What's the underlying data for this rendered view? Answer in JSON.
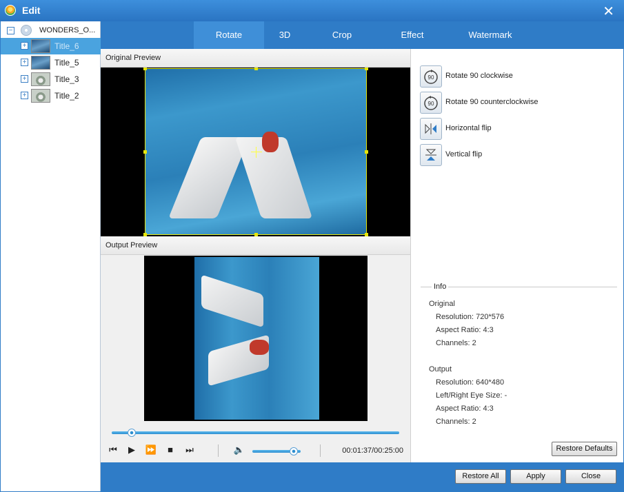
{
  "window": {
    "title": "Edit"
  },
  "tree": {
    "root_label": "WONDERS_O...",
    "items": [
      {
        "label": "Title_6",
        "selected": true,
        "thumb": "sea"
      },
      {
        "label": "Title_5",
        "selected": false,
        "thumb": "sea"
      },
      {
        "label": "Title_3",
        "selected": false,
        "thumb": "drop"
      },
      {
        "label": "Title_2",
        "selected": false,
        "thumb": "drop"
      }
    ]
  },
  "tabs": [
    {
      "label": "Rotate",
      "active": true
    },
    {
      "label": "3D",
      "active": false
    },
    {
      "label": "Crop",
      "active": false
    },
    {
      "label": "Effect",
      "active": false
    },
    {
      "label": "Watermark",
      "active": false
    }
  ],
  "previews": {
    "original_label": "Original Preview",
    "output_label": "Output Preview"
  },
  "player": {
    "timecode": "00:01:37/00:25:00",
    "progress_fraction": 0.07,
    "volume_fraction": 0.85
  },
  "rotate_options": [
    {
      "label": "Rotate 90 clockwise",
      "icon": "rotate-cw-icon"
    },
    {
      "label": "Rotate 90 counterclockwise",
      "icon": "rotate-ccw-icon"
    },
    {
      "label": "Horizontal flip",
      "icon": "horizontal-flip-icon"
    },
    {
      "label": "Vertical flip",
      "icon": "vertical-flip-icon"
    }
  ],
  "info": {
    "legend": "Info",
    "original_heading": "Original",
    "original": {
      "resolution": "Resolution: 720*576",
      "aspect": "Aspect Ratio: 4:3",
      "channels": "Channels: 2"
    },
    "output_heading": "Output",
    "output": {
      "resolution": "Resolution: 640*480",
      "eye": "Left/Right Eye Size: -",
      "aspect": "Aspect Ratio: 4:3",
      "channels": "Channels: 2"
    }
  },
  "buttons": {
    "restore_defaults": "Restore Defaults",
    "restore_all": "Restore All",
    "apply": "Apply",
    "close": "Close"
  },
  "colors": {
    "accent": "#2f7cc7",
    "selection": "#4aa3df",
    "crop_border": "#e6e60a"
  }
}
